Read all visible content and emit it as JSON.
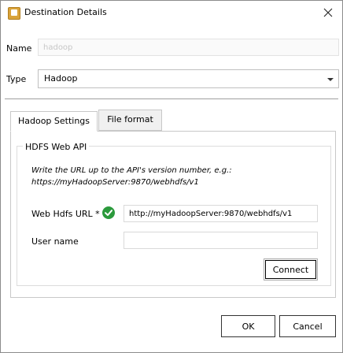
{
  "window": {
    "title": "Destination Details",
    "icon": "app-icon",
    "close_icon": "close-icon"
  },
  "form": {
    "name_label": "Name",
    "name_value": "hadoop",
    "type_label": "Type",
    "type_value": "Hadoop"
  },
  "tabs": [
    {
      "label": "Hadoop Settings",
      "active": true
    },
    {
      "label": "File format",
      "active": false
    }
  ],
  "hdfs": {
    "group_title": "HDFS Web API",
    "hint_line1": "Write the URL up to the API's version number, e.g.:",
    "hint_line2": "https://myHadoopServer:9870/webhdfs/v1",
    "url_label": "Web Hdfs URL *",
    "url_value": "http://myHadoopServer:9870/webhdfs/v1",
    "url_status_icon": "check-circle-icon",
    "username_label": "User name",
    "username_value": "",
    "connect_label": "Connect"
  },
  "footer": {
    "ok_label": "OK",
    "cancel_label": "Cancel"
  },
  "colors": {
    "valid": "#2b9a3c",
    "app_icon": "#d9a33a"
  }
}
